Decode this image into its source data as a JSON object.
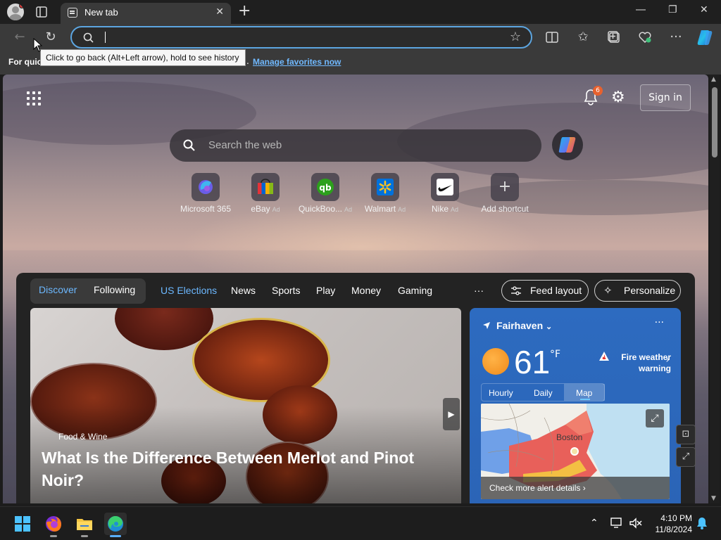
{
  "browser": {
    "tab": {
      "title": "New tab"
    },
    "toolbar": {
      "address_value": "",
      "tooltip": "Click to go back (Alt+Left arrow), hold to see history"
    },
    "favorites_bar": {
      "prompt": "For quic",
      "prompt_end": ".",
      "manage_link": "Manage favorites now"
    }
  },
  "newtab": {
    "header": {
      "notification_count": "6",
      "sign_in": "Sign in"
    },
    "search": {
      "placeholder": "Search the web"
    },
    "shortcuts": [
      {
        "label": "Microsoft 365",
        "ad": "",
        "icon": "microsoft365-icon"
      },
      {
        "label": "eBay",
        "ad": "Ad",
        "icon": "ebay-icon"
      },
      {
        "label": "QuickBoo...",
        "ad": "Ad",
        "icon": "quickbooks-icon"
      },
      {
        "label": "Walmart",
        "ad": "Ad",
        "icon": "walmart-icon"
      },
      {
        "label": "Nike",
        "ad": "Ad",
        "icon": "nike-icon"
      },
      {
        "label": "Add shortcut",
        "ad": "",
        "icon": "plus-icon"
      }
    ],
    "feed_nav": {
      "discover": "Discover",
      "following": "Following",
      "items": [
        "US Elections",
        "News",
        "Sports",
        "Play",
        "Money",
        "Gaming"
      ],
      "more": "···",
      "feed_layout": "Feed layout",
      "personalize": "Personalize"
    },
    "hero": {
      "category": "Food & Wine",
      "headline": "What Is the Difference Between Merlot and Pinot Noir?"
    },
    "weather": {
      "location": "Fairhaven",
      "temperature": "61",
      "unit": "°F",
      "warning": "Fire weather warning",
      "tabs": [
        "Hourly",
        "Daily",
        "Map"
      ],
      "selected_tab": "Map",
      "map_label": "Boston",
      "alert_link": "Check more alert details"
    }
  },
  "taskbar": {
    "time": "4:10 PM",
    "date": "11/8/2024"
  },
  "colors": {
    "accent": "#5ca5e0",
    "link": "#70b9ff",
    "weather_card": "#2d6bc0",
    "badge": "#e8612e",
    "alert_red": "#e8605a"
  }
}
